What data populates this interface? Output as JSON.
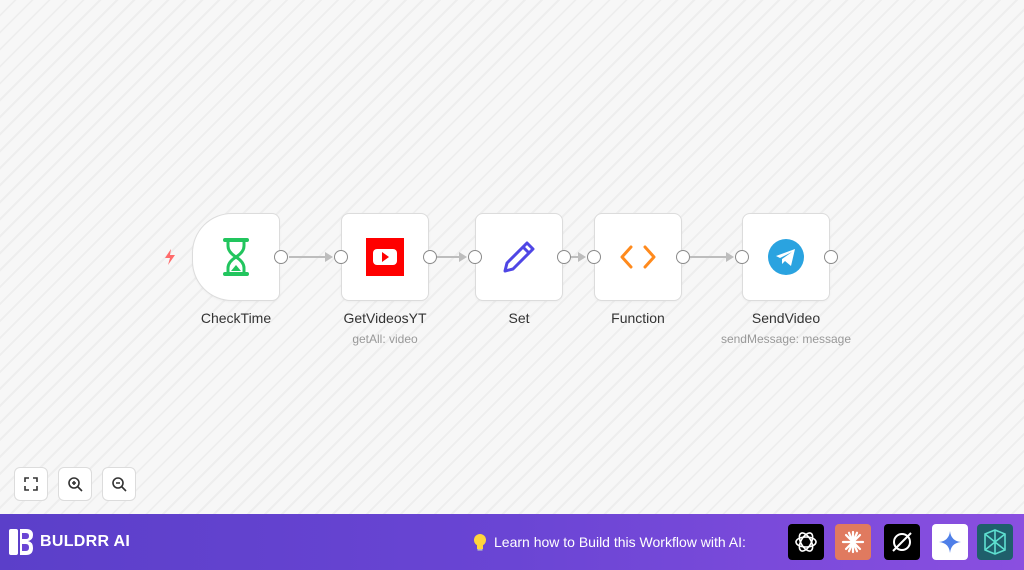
{
  "workflow": {
    "nodes": [
      {
        "label": "CheckTime",
        "sub": "",
        "icon": "hourglass-icon"
      },
      {
        "label": "GetVideosYT",
        "sub": "getAll: video",
        "icon": "youtube-icon"
      },
      {
        "label": "Set",
        "sub": "",
        "icon": "pencil-icon"
      },
      {
        "label": "Function",
        "sub": "",
        "icon": "code-icon"
      },
      {
        "label": "SendVideo",
        "sub": "sendMessage: message",
        "icon": "telegram-icon"
      }
    ]
  },
  "controls": {
    "fit_view": "fit-view-icon",
    "zoom_in": "zoom-in-icon",
    "zoom_out": "zoom-out-icon"
  },
  "bottombar": {
    "brand_name": "BULDRR AI",
    "learn_text": "Learn how to Build this Workflow with AI:",
    "ai_tools": [
      "chatgpt-icon",
      "claude-icon",
      "perplexity-icon",
      "gemini-icon",
      "deepseek-icon"
    ]
  },
  "colors": {
    "accent_purple": "#6a45d4",
    "youtube_red": "#ff0000",
    "hourglass_green": "#22c55e",
    "telegram_blue": "#2aa3e0",
    "function_orange": "#ff8a1d",
    "trigger_bolt": "#ff6b6b"
  }
}
